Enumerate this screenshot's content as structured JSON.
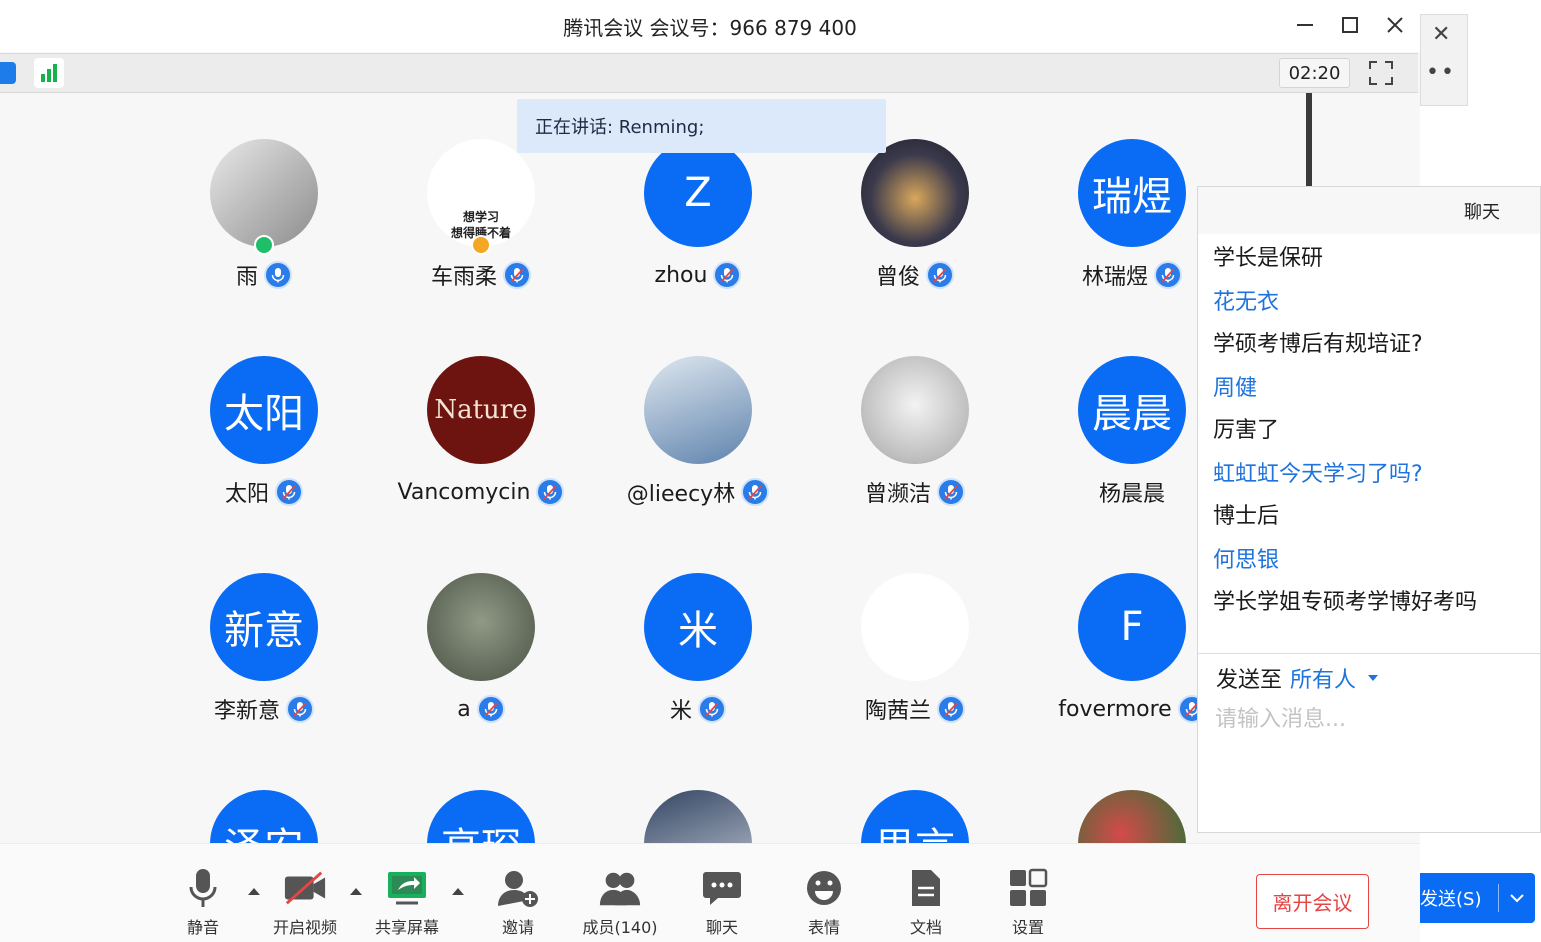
{
  "window": {
    "title": "腾讯会议 会议号：966 879 400",
    "minimize_icon": "minimize-icon",
    "maximize_icon": "maximize-icon",
    "close_icon": "close-icon"
  },
  "topbar": {
    "timer": "02:20",
    "signal_color": "#15b34c"
  },
  "speaking": {
    "text": "正在讲话: Renming;"
  },
  "participants": [
    {
      "name": "雨",
      "avatar_text": "",
      "avatar_kind": "photo",
      "mic": "active"
    },
    {
      "name": "车雨柔",
      "avatar_text": "想学习\n想得睡不着",
      "avatar_kind": "meme",
      "mic": "muted"
    },
    {
      "name": "zhou",
      "avatar_text": "Z",
      "avatar_kind": "blue",
      "mic": "muted"
    },
    {
      "name": "曾俊",
      "avatar_text": "",
      "avatar_kind": "photo-dark",
      "mic": "muted"
    },
    {
      "name": "林瑞煜",
      "avatar_text": "瑞煜",
      "avatar_kind": "blue",
      "mic": "muted"
    },
    {
      "name": "太阳",
      "avatar_text": "太阳",
      "avatar_kind": "blue",
      "mic": "muted"
    },
    {
      "name": "Vancomycin",
      "avatar_text": "Nature",
      "avatar_kind": "nature",
      "mic": "muted"
    },
    {
      "name": "@lieecy林",
      "avatar_text": "",
      "avatar_kind": "photo-girl",
      "mic": "muted"
    },
    {
      "name": "曾濒洁",
      "avatar_text": "",
      "avatar_kind": "photo-cat",
      "mic": "muted"
    },
    {
      "name": "杨晨晨",
      "avatar_text": "晨晨",
      "avatar_kind": "blue",
      "mic": "none"
    },
    {
      "name": "李新意",
      "avatar_text": "新意",
      "avatar_kind": "blue",
      "mic": "muted"
    },
    {
      "name": "a",
      "avatar_text": "",
      "avatar_kind": "photo-tom",
      "mic": "muted"
    },
    {
      "name": "米",
      "avatar_text": "米",
      "avatar_kind": "blue",
      "mic": "muted"
    },
    {
      "name": "陶茜兰",
      "avatar_text": "",
      "avatar_kind": "photo-white",
      "mic": "muted"
    },
    {
      "name": "fovermore",
      "avatar_text": "F",
      "avatar_kind": "blue",
      "mic": "muted"
    },
    {
      "name": "",
      "avatar_text": "泽安",
      "avatar_kind": "blue",
      "mic": "none"
    },
    {
      "name": "",
      "avatar_text": "高琛",
      "avatar_kind": "blue",
      "mic": "none"
    },
    {
      "name": "",
      "avatar_text": "",
      "avatar_kind": "photo-boy",
      "mic": "none"
    },
    {
      "name": "",
      "avatar_text": "思言",
      "avatar_kind": "blue",
      "mic": "none"
    },
    {
      "name": "",
      "avatar_text": "",
      "avatar_kind": "photo-flower",
      "mic": "none"
    }
  ],
  "bottom": {
    "mute": "静音",
    "video": "开启视频",
    "share": "共享屏幕",
    "invite": "邀请",
    "members": "成员(140)",
    "chat": "聊天",
    "emoji": "表情",
    "docs": "文档",
    "settings": "设置",
    "leave": "离开会议"
  },
  "background": {
    "send_button": "发送(S)"
  },
  "chat": {
    "title": "聊天",
    "messages": [
      {
        "type": "msg",
        "text": "学长是保研"
      },
      {
        "type": "sender",
        "text": "花无衣"
      },
      {
        "type": "msg",
        "text": "学硕考博后有规培证?"
      },
      {
        "type": "sender",
        "text": "周健"
      },
      {
        "type": "msg",
        "text": "厉害了"
      },
      {
        "type": "sender",
        "text": "虹虹虹今天学习了吗?"
      },
      {
        "type": "msg",
        "text": "博士后"
      },
      {
        "type": "sender",
        "text": "何思银"
      },
      {
        "type": "msg",
        "text": "学长学姐专硕考学博好考吗"
      }
    ],
    "send_to_label": "发送至",
    "send_to_target": "所有人",
    "input_placeholder": "请输入消息..."
  },
  "colors": {
    "accent": "#0a6cf5",
    "sender_blue": "#1e73dc",
    "leave_red": "#e54545",
    "banner_bg": "#dbe9fb"
  }
}
